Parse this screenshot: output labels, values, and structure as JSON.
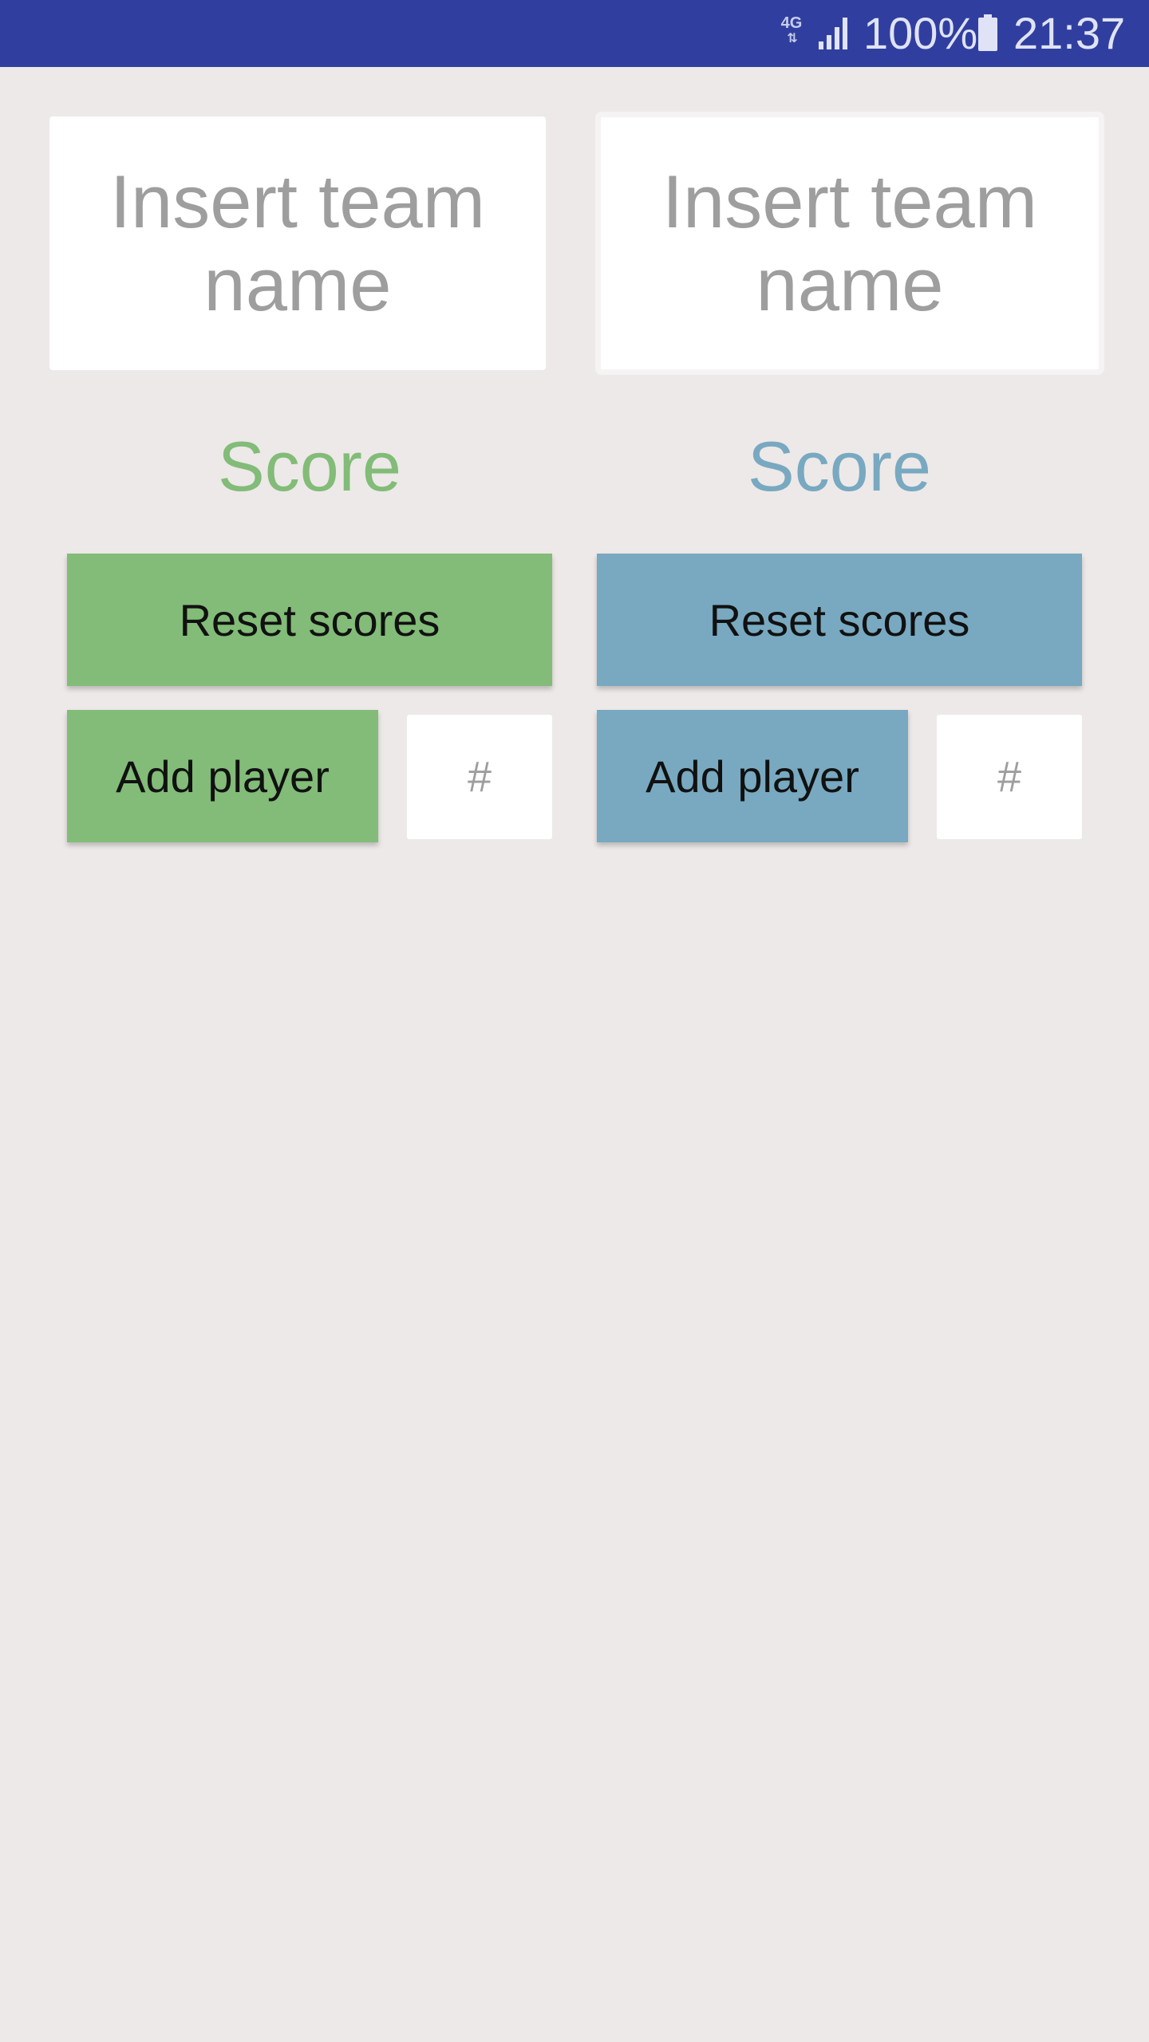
{
  "status_bar": {
    "network_type": "4G",
    "network_arrows": "⇅",
    "battery_percent": "100%",
    "time": "21:37",
    "background_color": "#303f9f",
    "icons": [
      "network-4g-icon",
      "signal-icon",
      "battery-icon"
    ]
  },
  "team_left": {
    "name_placeholder": "Insert team name",
    "score_label": "Score",
    "reset_label": "Reset scores",
    "add_player_label": "Add player",
    "number_placeholder": "#",
    "color": "#82bc78"
  },
  "team_right": {
    "name_placeholder": "Insert team name",
    "score_label": "Score",
    "reset_label": "Reset scores",
    "add_player_label": "Add player",
    "number_placeholder": "#",
    "color": "#78a9c0"
  },
  "colors": {
    "background": "#ede9e8",
    "placeholder_text": "#9e9e9e"
  }
}
